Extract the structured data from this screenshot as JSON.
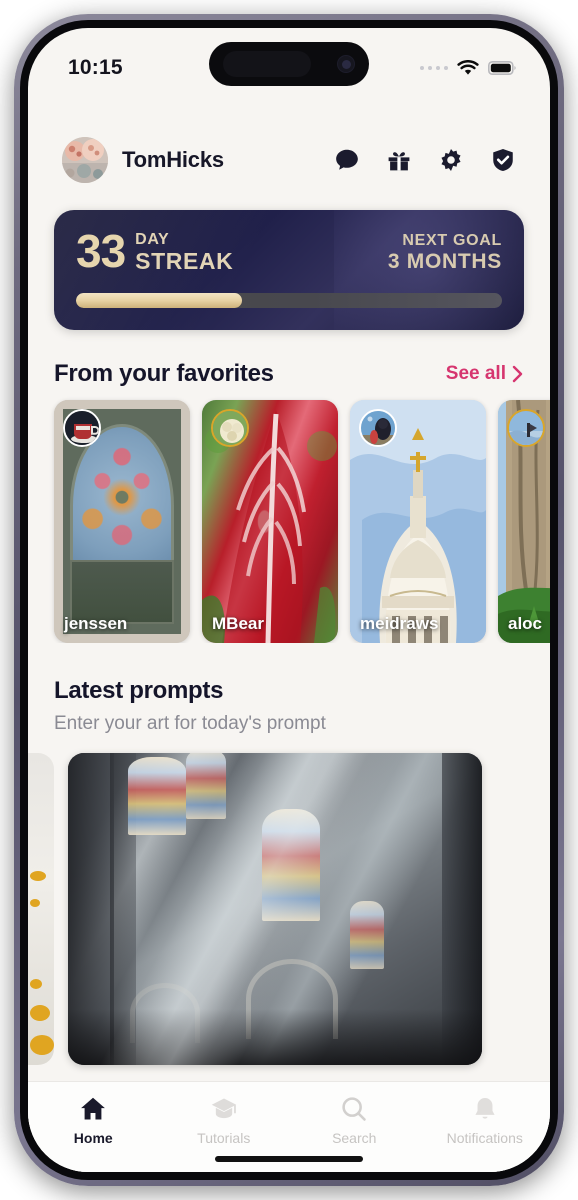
{
  "status_bar": {
    "time": "10:15",
    "signal_icon": "signal-dots-icon",
    "wifi_icon": "wifi-icon",
    "battery_icon": "battery-full-icon"
  },
  "header": {
    "avatar_name": "user-avatar",
    "username": "TomHicks",
    "actions": [
      {
        "name": "messages-icon",
        "label": "Messages"
      },
      {
        "name": "gift-icon",
        "label": "Gifts"
      },
      {
        "name": "settings-gear-icon",
        "label": "Settings"
      },
      {
        "name": "shield-check-icon",
        "label": "Safety"
      }
    ]
  },
  "streak_card": {
    "count": "33",
    "unit_line1": "DAY",
    "unit_line2": "STREAK",
    "goal_label": "NEXT GOAL",
    "goal_value": "3 MONTHS",
    "progress_percent": 39,
    "accent_color": "#e6d5ae",
    "background_color": "#1f1f44"
  },
  "favorites": {
    "title": "From your favorites",
    "see_all_label": "See all",
    "see_all_icon": "chevron-right-icon",
    "see_all_color": "#d6356f",
    "cards": [
      {
        "username": "jenssen",
        "art": "stained-glass-rose-window",
        "avatar": "coffee-cup-avatar",
        "ringed": false
      },
      {
        "username": "MBear",
        "art": "red-leaf-painting",
        "avatar": "flower-avatar",
        "ringed": true
      },
      {
        "username": "meidraws",
        "art": "cathedral-dome-watercolor",
        "avatar": "person-avatar",
        "ringed": false
      },
      {
        "username": "aloc",
        "art": "forest-trees-painting",
        "avatar": "landscape-avatar",
        "ringed": true
      }
    ]
  },
  "latest_prompts": {
    "title": "Latest prompts",
    "subtitle": "Enter your art for today's prompt",
    "cards": [
      {
        "name": "previous-prompt-card",
        "art": "partial-yellow-artwork"
      },
      {
        "name": "current-prompt-card",
        "art": "cathedral-interior-light-rays"
      }
    ]
  },
  "tab_bar": {
    "items": [
      {
        "label": "Home",
        "icon": "home-icon",
        "active": true
      },
      {
        "label": "Tutorials",
        "icon": "graduation-cap-icon",
        "active": false
      },
      {
        "label": "Search",
        "icon": "search-icon",
        "active": false
      },
      {
        "label": "Notifications",
        "icon": "bell-icon",
        "active": false
      }
    ]
  }
}
